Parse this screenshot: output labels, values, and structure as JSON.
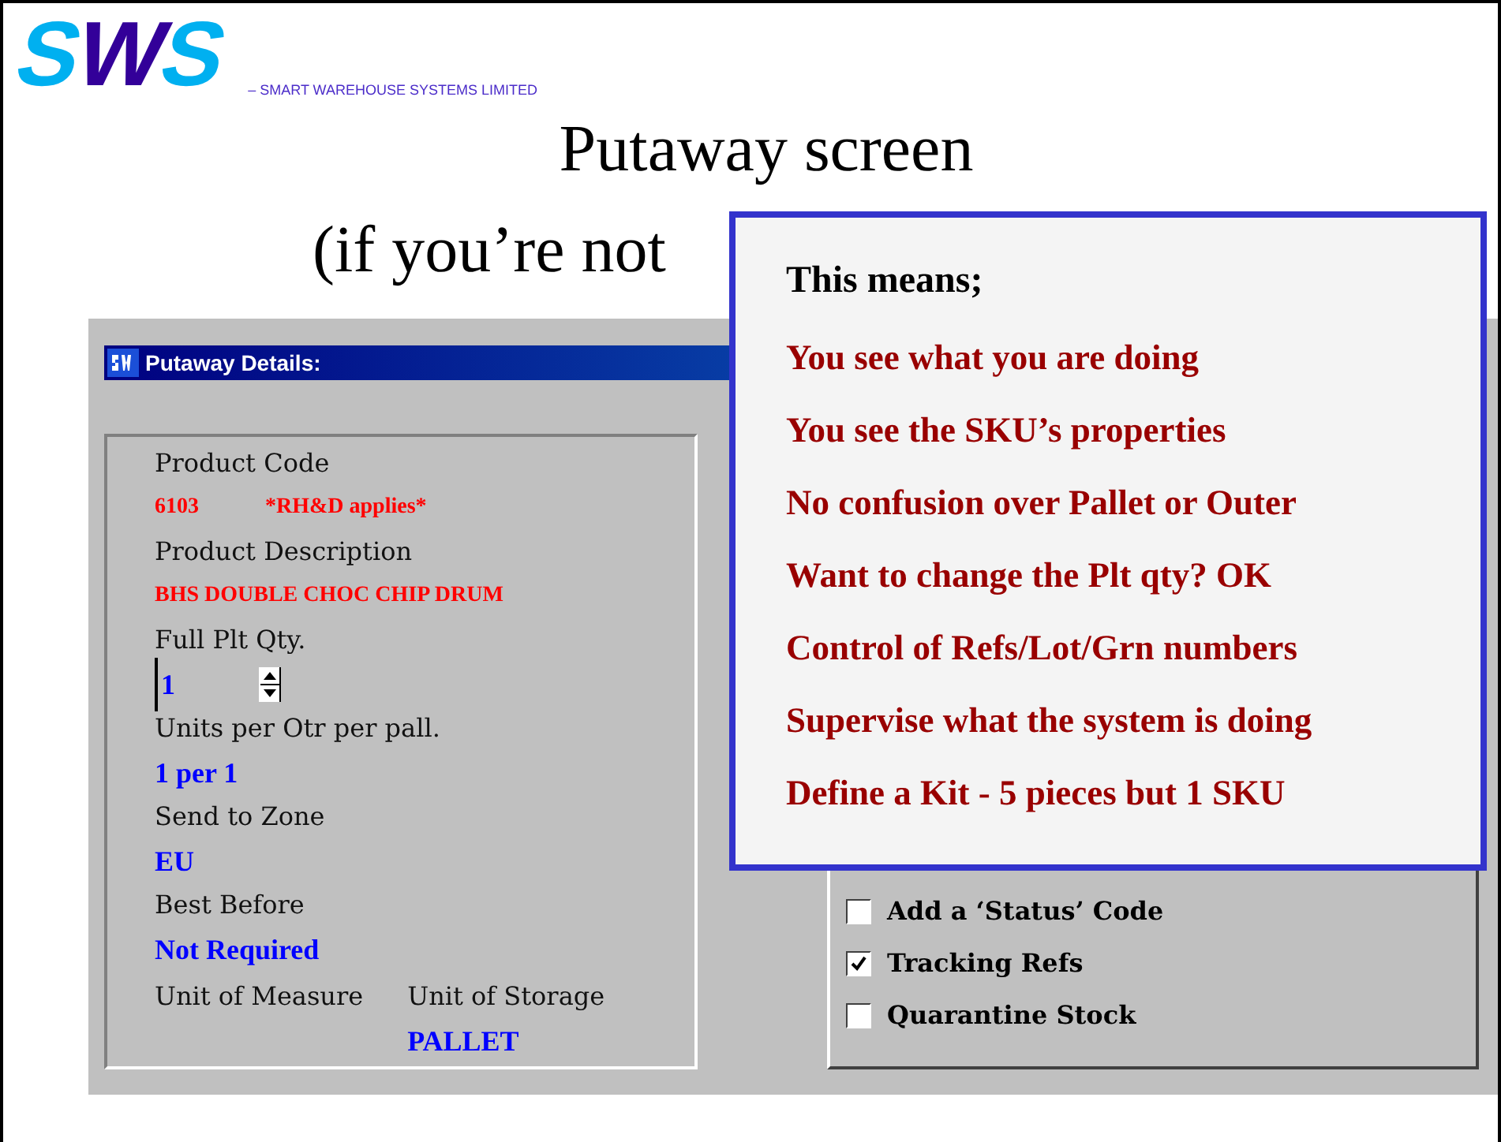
{
  "logo": {
    "letters": [
      "S",
      "W",
      "S"
    ],
    "tagline": "– SMART WAREHOUSE SYSTEMS LIMITED"
  },
  "slide": {
    "title": "Putaway screen",
    "subtitle": "(if you’re not"
  },
  "window": {
    "title": "Putaway Details:"
  },
  "details": [
    {
      "kind": "text",
      "label": "Product Code",
      "values": [
        {
          "text": "6103",
          "color": "#ff0000"
        },
        {
          "text": "*RH&D applies*",
          "color": "#ff0000"
        }
      ]
    },
    {
      "kind": "text",
      "label": "Product Description",
      "values": [
        {
          "text": "BHS DOUBLE CHOC CHIP DRUM",
          "color": "#ff0000"
        }
      ]
    },
    {
      "kind": "spinner",
      "label": "Full Plt Qty.",
      "values": [
        {
          "text": "1",
          "color": "#0000ff"
        }
      ]
    },
    {
      "kind": "text",
      "label": "Units per Otr per pall.",
      "values": [
        {
          "text": "1 per 1",
          "color": "#0000ff"
        }
      ]
    },
    {
      "kind": "text",
      "label": "Send to Zone",
      "values": [
        {
          "text": "EU",
          "color": "#0000ff"
        }
      ]
    },
    {
      "kind": "text",
      "label": "Best Before",
      "values": [
        {
          "text": "Not Required",
          "color": "#0000ff"
        }
      ]
    }
  ],
  "units": [
    {
      "label": "Unit of Measure"
    },
    {
      "label": "Unit of Storage",
      "value": "PALLET"
    }
  ],
  "options": [
    {
      "label": "Add a ‘Status’ Code",
      "checked": false
    },
    {
      "label": "Tracking Refs",
      "checked": true
    },
    {
      "label": "Quarantine Stock",
      "checked": false
    }
  ],
  "callout": {
    "heading": "This means;",
    "points": [
      "You see what you are doing",
      "You see the SKU’s properties",
      "No confusion over Pallet or Outer",
      "Want to change the Plt qty? OK",
      "Control of Refs/Lot/Grn numbers",
      "Supervise what the system is doing",
      "Define a Kit - 5 pieces but 1 SKU"
    ]
  }
}
